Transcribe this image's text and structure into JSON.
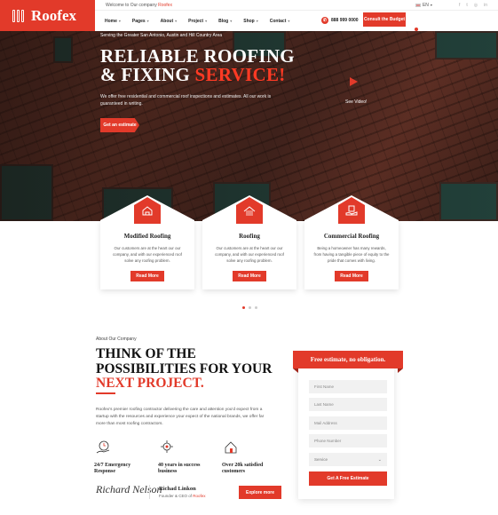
{
  "brand": {
    "name": "Roofex"
  },
  "topbar": {
    "welcome_prefix": "Welcome to Our company",
    "welcome_brand": "Roofex",
    "language": "EN"
  },
  "nav": {
    "items": [
      "Home",
      "Pages",
      "About",
      "Project",
      "Blog",
      "Shop",
      "Contact"
    ],
    "phone": "888 999 0000",
    "cta": "Consult the Budget"
  },
  "hero": {
    "tagline": "Serving the Greater San Antonio, Austin and Hill Country Area",
    "headline_line1": "RELIABLE ROOFING",
    "headline_line2_prefix": "& FIXING",
    "headline_line2_accent": "SERVICE!",
    "description": "We offer free residential and commercial roof inspections and estimates. All our work is guaranteed in writing.",
    "cta": "Get an estimate",
    "video_label": "See Video!"
  },
  "services": [
    {
      "title": "Modified Roofing",
      "text": "Our customers are at the heart our our company, and with our experienced roof solve any roofing problem.",
      "cta": "Read More",
      "icon": "hammer-house-icon"
    },
    {
      "title": "Roofing",
      "text": "Our customers are at the heart our our company, and with our experienced roof solve any roofing problem.",
      "cta": "Read More",
      "icon": "roof-tiles-icon"
    },
    {
      "title": "Commercial Roofing",
      "text": "Being a homeowner has many rewards, from having a tangible piece of equity to the pride that comes with living.",
      "cta": "Read More",
      "icon": "building-hand-icon"
    }
  ],
  "about": {
    "label": "About Our Company",
    "heading_line1": "THINK OF THE",
    "heading_line2": "POSSIBILITIES FOR YOUR",
    "heading_accent": "NEXT PROJECT.",
    "paragraph": "Roofex's premier roofing contractor delivering the care and attention you'd expect from a startup with the resources and experience your expect of the national brands, we offer far more than most roofing contractors.",
    "features": [
      {
        "text_line1": "24/7 Emergency",
        "text_line2": "Response",
        "icon": "clock-hand-icon"
      },
      {
        "text_line1": "40 years in success",
        "text_line2": "business",
        "icon": "gear-award-icon"
      },
      {
        "text_line1": "Over 20k satisfied",
        "text_line2": "customers",
        "icon": "house-people-icon"
      }
    ],
    "signature": "Richard Nelson",
    "owner_name": "Richad Linkon",
    "owner_role_prefix": "Founder & CEO of",
    "owner_role_brand": "Roofex",
    "cta": "Explore more"
  },
  "form": {
    "title": "Free estimate, no obligation.",
    "first_name_placeholder": "First Name",
    "last_name_placeholder": "Last Name",
    "mail_placeholder": "Mail Address",
    "phone_placeholder": "Phone Number",
    "service_selected": "Service",
    "submit": "Get A Free Estimate"
  },
  "colors": {
    "accent": "#e23a2a"
  }
}
